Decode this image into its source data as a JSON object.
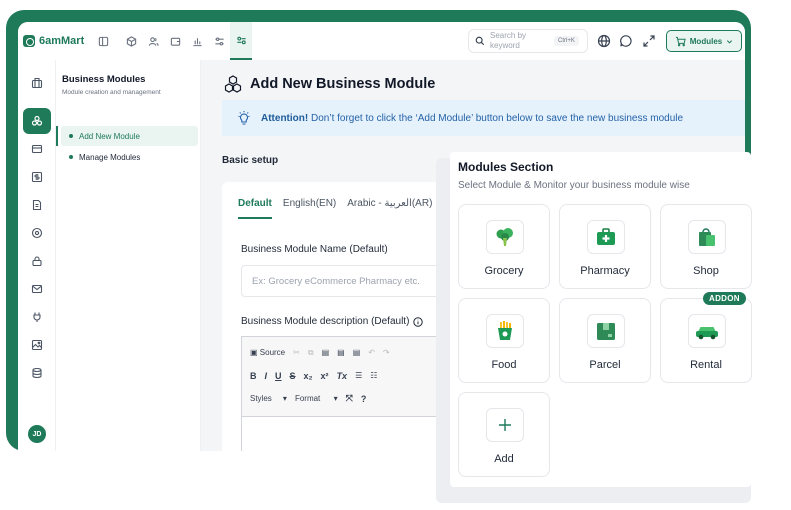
{
  "app": {
    "logo_text": "6amMart"
  },
  "topbar": {
    "search_placeholder": "Search by keyword",
    "search_shortcut": "Ctrl+K",
    "modules_button": "Modules"
  },
  "sidebar": {
    "title": "Business Modules",
    "subtitle": "Module creation and management",
    "items": [
      {
        "label": "Add New Module",
        "active": true
      },
      {
        "label": "Manage Modules",
        "active": false
      }
    ],
    "user_initials": "JD"
  },
  "main": {
    "page_title": "Add New Business Module",
    "alert": {
      "strong": "Attention!",
      "text": " Don’t forget to click the ‘Add Module’ button below to save the new business module"
    },
    "section_label": "Basic setup",
    "tabs": [
      "Default",
      "English(EN)",
      "Arabic - العربية(AR)"
    ],
    "name_label": "Business Module Name (Default)",
    "name_placeholder": "Ex: Grocery eCommerce Pharmacy etc.",
    "description_label": "Business Module description (Default)",
    "editor": {
      "source": "Source",
      "styles": "Styles",
      "format": "Format"
    }
  },
  "modules_panel": {
    "title": "Modules Section",
    "subtitle": "Select Module & Monitor your business module wise",
    "modules": [
      {
        "label": "Grocery",
        "icon": "broccoli-icon"
      },
      {
        "label": "Pharmacy",
        "icon": "medical-kit-icon"
      },
      {
        "label": "Shop",
        "icon": "shopping-bag-icon"
      },
      {
        "label": "Food",
        "icon": "fries-icon"
      },
      {
        "label": "Parcel",
        "icon": "parcel-box-icon"
      },
      {
        "label": "Rental",
        "icon": "car-icon",
        "badge": "ADDON"
      },
      {
        "label": "Add",
        "icon": "plus-icon"
      }
    ]
  },
  "colors": {
    "brand": "#1f7a5a",
    "alert_bg": "#e5f1fb",
    "alert_text": "#2563a8"
  }
}
